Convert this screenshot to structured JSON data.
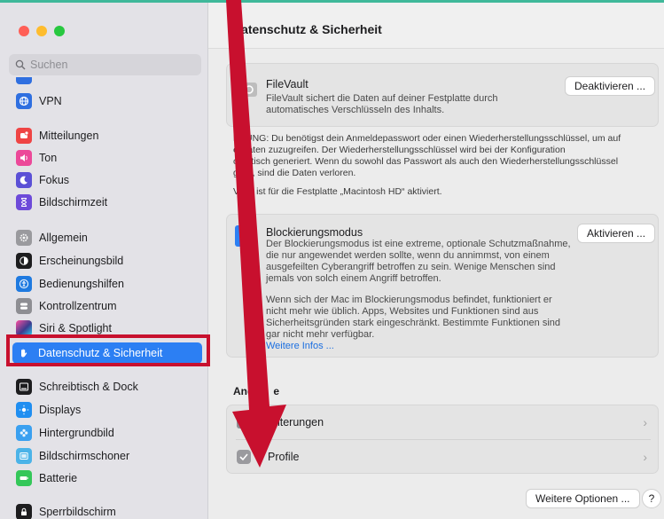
{
  "window_title": "Datenschutz & Sicherheit",
  "search": {
    "placeholder": "Suchen"
  },
  "sidebar": {
    "items": [
      {
        "label": "VPN",
        "color": "#2f6fe0"
      },
      {
        "label": "Mitteilungen",
        "color": "#ef4444"
      },
      {
        "label": "Ton",
        "color": "#ec4899"
      },
      {
        "label": "Fokus",
        "color": "#5b50d6"
      },
      {
        "label": "Bildschirmzeit",
        "color": "#6d4ad9"
      },
      {
        "label": "Allgemein",
        "color": "#9a9a9e"
      },
      {
        "label": "Erscheinungsbild",
        "color": "#1d1d1f"
      },
      {
        "label": "Bedienungshilfen",
        "color": "#1f7ae0"
      },
      {
        "label": "Kontrollzentrum",
        "color": "#8e8e93"
      },
      {
        "label": "Siri & Spotlight",
        "color": "#3b3b8e"
      },
      {
        "label": "Datenschutz & Sicherheit",
        "color": "#2c7ff3"
      },
      {
        "label": "Schreibtisch & Dock",
        "color": "#1d1d1f"
      },
      {
        "label": "Displays",
        "color": "#1f8ef1"
      },
      {
        "label": "Hintergrundbild",
        "color": "#3aa0f0"
      },
      {
        "label": "Bildschirmschoner",
        "color": "#4bb3e8"
      },
      {
        "label": "Batterie",
        "color": "#34c759"
      },
      {
        "label": "Sperrbildschirm",
        "color": "#1d1d1f"
      }
    ],
    "active_index": 10
  },
  "filevault": {
    "title": "FileVault",
    "desc_line1": "FileVault sichert die Daten auf deiner Festplatte durch",
    "desc_line2": "automatisches Verschlüsseln des Inhalts.",
    "button": "Deaktivieren ...",
    "warning_line1": "HTUNG: Du benötigst dein Anmeldepasswort oder einen Wiederherstellungsschlüssel, um auf",
    "warning_line2": "e Daten zuzugreifen. Der Wiederherstellungsschlüssel wird bei der Konfiguration",
    "warning_line3": "omatisch generiert. Wenn du sowohl das Passwort als auch den Wiederherstellungsschlüssel",
    "warning_line4": "gisst, sind die Daten verloren.",
    "status": "Vault ist für die Festplatte „Macintosh HD“ aktiviert."
  },
  "lockdown": {
    "title": "Blockierungsmodus",
    "button": "Aktivieren ...",
    "desc_line1": "Der Blockierungsmodus ist eine extreme, optionale Schutzmaßnahme,",
    "desc_line2": "die nur angewendet werden sollte, wenn du annimmst, von einem",
    "desc_line3": "ausgefeilten Cyberangriff betroffen zu sein. Wenige Menschen sind",
    "desc_line4": "jemals von solch einem Angriff betroffen.",
    "desc_line5": "Wenn sich der Mac im Blockierungsmodus befindet, funktioniert er",
    "desc_line6": "nicht mehr wie üblich. Apps, Websites und Funktionen sind aus",
    "desc_line7": "Sicherheitsgründen stark eingeschränkt. Bestimmte Funktionen sind",
    "desc_line8": "gar nicht mehr verfügbar.",
    "link": "Weitere Infos ..."
  },
  "other": {
    "heading": "And",
    "heading_tail": "e",
    "rows": [
      {
        "label": "eiterungen"
      },
      {
        "label": "Profile"
      }
    ]
  },
  "footer": {
    "more_button": "Weitere Optionen ...",
    "help": "?"
  },
  "colors": {
    "accent": "#2c7ff3",
    "annotation": "#c8102e"
  }
}
